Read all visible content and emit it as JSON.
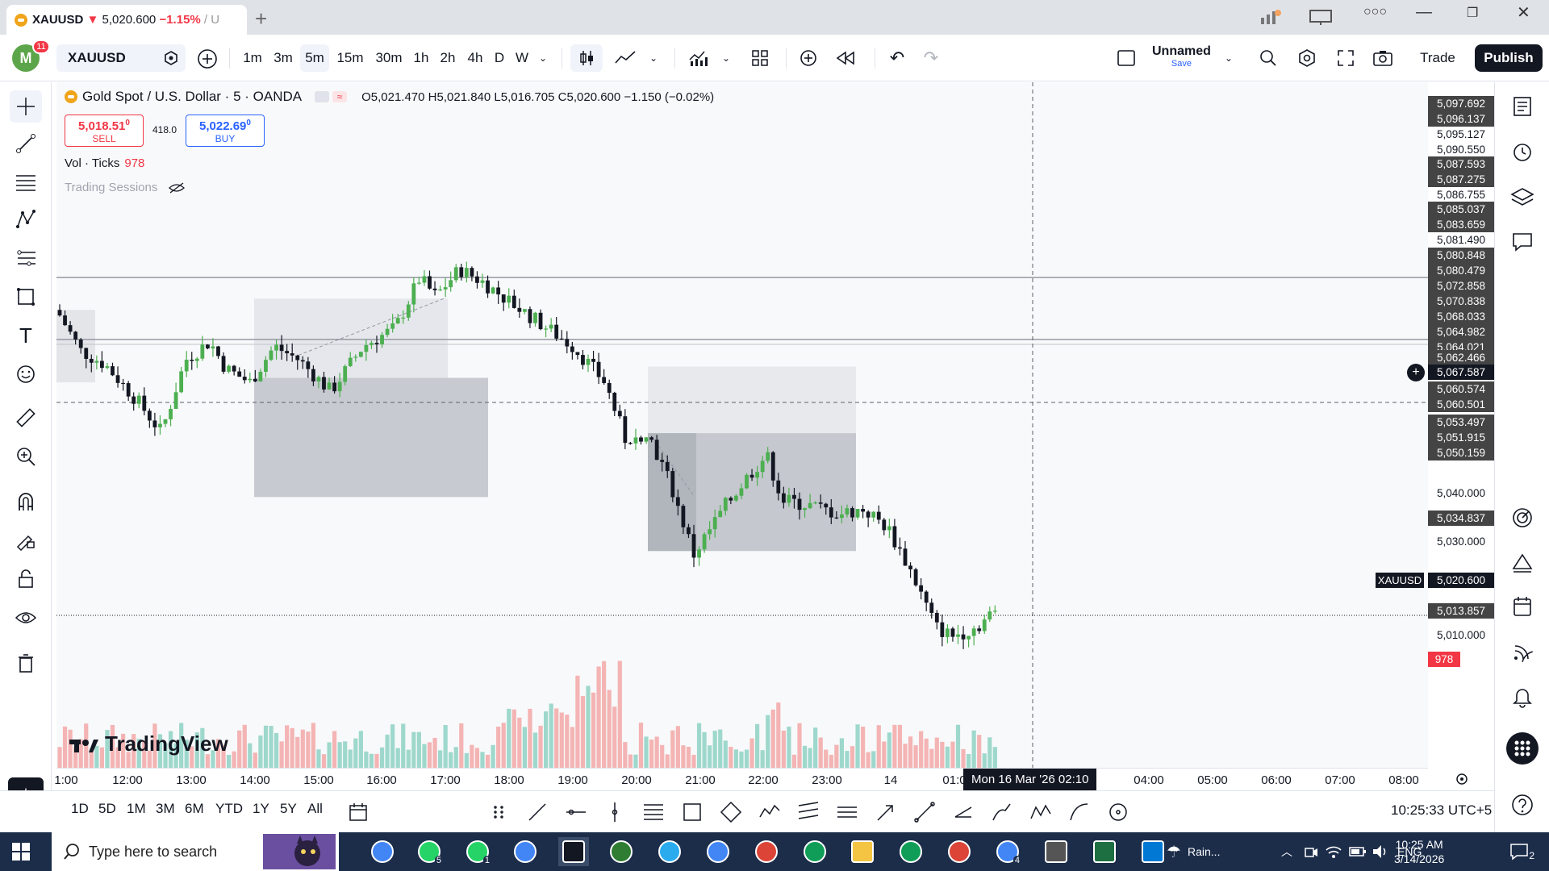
{
  "browser": {
    "tab": {
      "symbol": "XAUUSD",
      "arrow": "▼",
      "price": "5,020.600",
      "change": "−1.15%",
      "rest": "/ U"
    },
    "new_tab": "+",
    "controls": [
      "minimize-icon",
      "restore-icon",
      "close-icon"
    ]
  },
  "header": {
    "avatar_letter": "M",
    "notifications": "11",
    "symbol": "XAUUSD",
    "intervals": [
      "1m",
      "3m",
      "5m",
      "15m",
      "30m",
      "1h",
      "2h",
      "4h",
      "D",
      "W"
    ],
    "active_interval": "5m",
    "layout_name": "Unnamed",
    "layout_save": "Save",
    "trade": "Trade",
    "publish": "Publish"
  },
  "legend": {
    "title": "Gold Spot / U.S. Dollar · 5 · OANDA",
    "open": "O5,021.470",
    "high": "H5,021.840",
    "low": "L5,016.705",
    "close": "C5,020.600",
    "change": "−1.150 (−0.02%)",
    "sell_price": "5,018.51",
    "sell_price_sup": "0",
    "sell_label": "SELL",
    "spread": "418.0",
    "buy_price": "5,022.69",
    "buy_price_sup": "0",
    "buy_label": "BUY",
    "vol_label": "Vol · Ticks",
    "vol_value": "978",
    "sessions_label": "Trading Sessions"
  },
  "watermark": "TradingView",
  "price_axis": {
    "labels": [
      {
        "text": "5,097.692",
        "style": "tag"
      },
      {
        "text": "5,096.137",
        "style": "tag"
      },
      {
        "text": "5,095.127",
        "style": "plain"
      },
      {
        "text": "5,090.550",
        "style": "plain"
      },
      {
        "text": "5,087.593",
        "style": "tag"
      },
      {
        "text": "5,087.275",
        "style": "tag"
      },
      {
        "text": "5,086.755",
        "style": "plain"
      },
      {
        "text": "5,085.037",
        "style": "tag"
      },
      {
        "text": "5,083.659",
        "style": "tag"
      },
      {
        "text": "5,081.490",
        "style": "plain"
      },
      {
        "text": "5,080.848",
        "style": "tag"
      },
      {
        "text": "5,080.479",
        "style": "tag"
      },
      {
        "text": "5,072.858",
        "style": "tag"
      },
      {
        "text": "5,070.838",
        "style": "tag"
      },
      {
        "text": "5,068.033",
        "style": "tag"
      },
      {
        "text": "5,064.982",
        "style": "tag"
      },
      {
        "text": "5,064.021",
        "style": "tag"
      },
      {
        "text": "5,062.466",
        "style": "tag"
      },
      {
        "text": "5,067.587",
        "style": "cross"
      },
      {
        "text": "5,060.574",
        "style": "tag"
      },
      {
        "text": "5,060.501",
        "style": "tag"
      },
      {
        "text": "5,053.497",
        "style": "tag"
      },
      {
        "text": "5,051.915",
        "style": "tag"
      },
      {
        "text": "5,050.159",
        "style": "tag"
      },
      {
        "text": "5,040.000",
        "style": "plain"
      },
      {
        "text": "5,034.837",
        "style": "tag"
      },
      {
        "text": "5,030.000",
        "style": "plain"
      },
      {
        "text": "5,020.600",
        "style": "cross"
      },
      {
        "text": "5,013.857",
        "style": "tag"
      },
      {
        "text": "5,010.000",
        "style": "plain"
      },
      {
        "text": "978",
        "style": "red"
      }
    ],
    "symbol_tag": "XAUUSD"
  },
  "time_axis": {
    "labels": [
      "1:00",
      "12:00",
      "13:00",
      "14:00",
      "15:00",
      "16:00",
      "17:00",
      "18:00",
      "19:00",
      "20:00",
      "21:00",
      "22:00",
      "23:00",
      "14",
      "01:0",
      "04:00",
      "05:00",
      "06:00",
      "07:00",
      "08:00"
    ],
    "crosshair": "Mon 16 Mar '26   02:10"
  },
  "bottom_bar": {
    "ranges": [
      "1D",
      "5D",
      "1M",
      "3M",
      "6M",
      "YTD",
      "1Y",
      "5Y",
      "All"
    ],
    "clock": "10:25:33 UTC+5"
  },
  "taskbar": {
    "search_placeholder": "Type here to search",
    "weather": "Rain...",
    "language": "ENG",
    "time": "10:25 AM",
    "date": "3/14/2026",
    "notifications": "2",
    "whatsapp1": "5",
    "whatsapp2": "1",
    "chrome_badge": "4"
  },
  "colors": {
    "up": "#26a69a",
    "up_candle": "#4caf50",
    "down": "#131722",
    "vol_up": "#9ed8cc",
    "vol_down": "#f4b4b4",
    "accent": "#2962ff",
    "red": "#f23645"
  }
}
